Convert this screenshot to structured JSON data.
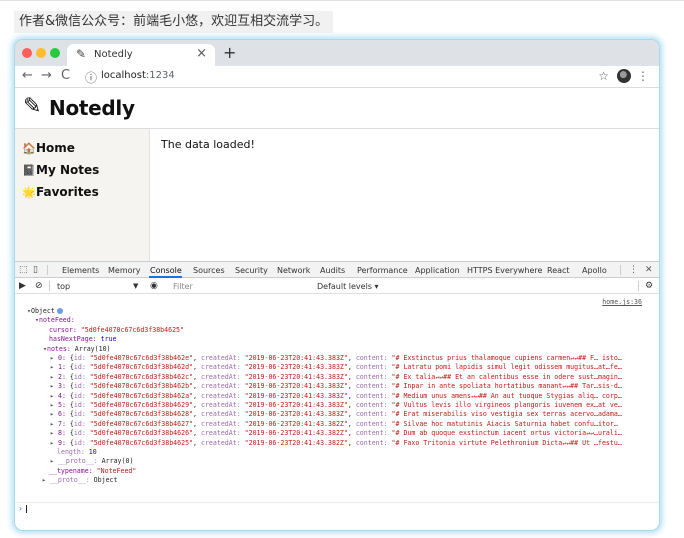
{
  "caption": "作者&微信公众号：前端毛小悠，欢迎互相交流学习。",
  "browser": {
    "tab_title": "Notedly",
    "tab_icon": "edit-icon",
    "url_host": "localhost",
    "url_port": ":1234"
  },
  "app": {
    "logo": "Notedly",
    "nav": [
      {
        "label": "Home",
        "icon": "🏠"
      },
      {
        "label": "My Notes",
        "icon": "📓"
      },
      {
        "label": "Favorites",
        "icon": "🌟"
      }
    ],
    "content_text": "The data loaded!"
  },
  "devtools": {
    "tabs": [
      "Elements",
      "Memory",
      "Console",
      "Sources",
      "Security",
      "Network",
      "Audits",
      "Performance",
      "Application",
      "HTTPS Everywhere",
      "React",
      "Apollo"
    ],
    "active_tab": "Console",
    "context": "top",
    "filter_placeholder": "Filter",
    "levels": "Default levels ▾",
    "source_link": "home.js:36",
    "tree": {
      "root": "Object",
      "noteFeed_key": "noteFeed:",
      "cursor_key": "cursor:",
      "cursor_val": "\"5d0fe4070c67c6d3f38b4625\"",
      "hasNext_key": "hasNextPage:",
      "hasNext_val": "true",
      "notes_key": "notes:",
      "notes_val": "Array(10)",
      "length_key": "length:",
      "length_val": "10",
      "proto_arr_key": "__proto__:",
      "proto_arr_val": "Array(0)",
      "typename_key": "__typename:",
      "typename_val": "\"NoteFeed\"",
      "proto_obj_key": "__proto__:",
      "proto_obj_val": "Object"
    },
    "notes": [
      {
        "idx": "0",
        "id": "\"5d0fe4070c67c6d3f38b462e\"",
        "createdAt": "\"2019-06-23T20:41:43.383Z\"",
        "content": "\"# Exstinctus prius thalamoque cupiens carmen↵↵## F… isto…"
      },
      {
        "idx": "1",
        "id": "\"5d0fe4070c67c6d3f38b462d\"",
        "createdAt": "\"2019-06-23T20:41:43.383Z\"",
        "content": "\"# Latratu pomi lapidis simul legit odissem mugitus…at…fe…"
      },
      {
        "idx": "2",
        "id": "\"5d0fe4070c67c6d3f38b462c\"",
        "createdAt": "\"2019-06-23T20:41:43.383Z\"",
        "content": "\"# Ex talia↵↵## Et an calentibus esse in odere sust…magin…"
      },
      {
        "idx": "3",
        "id": "\"5d0fe4070c67c6d3f38b462b\"",
        "createdAt": "\"2019-06-23T20:41:43.383Z\"",
        "content": "\"# Inpar in ante spoliata hortatibus manant↵↵## Tar…sis-d…"
      },
      {
        "idx": "4",
        "id": "\"5d0fe4070c67c6d3f38b462a\"",
        "createdAt": "\"2019-06-23T20:41:43.383Z\"",
        "content": "\"# Medium unus amens↵↵## An aut tuoque Stygias aliq… corp…"
      },
      {
        "idx": "5",
        "id": "\"5d0fe4070c67c6d3f38b4629\"",
        "createdAt": "\"2019-06-23T20:41:43.383Z\"",
        "content": "\"# Vultus levis illo virgineos plangoris iuvenem ex…at ve…"
      },
      {
        "idx": "6",
        "id": "\"5d0fe4070c67c6d3f38b4628\"",
        "createdAt": "\"2019-06-23T20:41:43.383Z\"",
        "content": "\"# Erat miserabilis viso vestigia sex terras acervo…adama…"
      },
      {
        "idx": "7",
        "id": "\"5d0fe4070c67c6d3f38b4627\"",
        "createdAt": "\"2019-06-23T20:41:43.382Z\"",
        "content": "\"# Silvae hoc matutinis Aiacis Saturnia habet confu…itor…"
      },
      {
        "idx": "8",
        "id": "\"5d0fe4070c67c6d3f38b4626\"",
        "createdAt": "\"2019-06-23T20:41:43.382Z\"",
        "content": "\"# Dum ab quoque exstinctum iacent ortus victoria↵↵…urali…"
      },
      {
        "idx": "9",
        "id": "\"5d0fe4070c67c6d3f38b4625\"",
        "createdAt": "\"2019-06-23T20:41:43.382Z\"",
        "content": "\"# Faxo Tritonia virtute Pelethronium Dicta↵↵## Ut …festu…"
      }
    ]
  }
}
